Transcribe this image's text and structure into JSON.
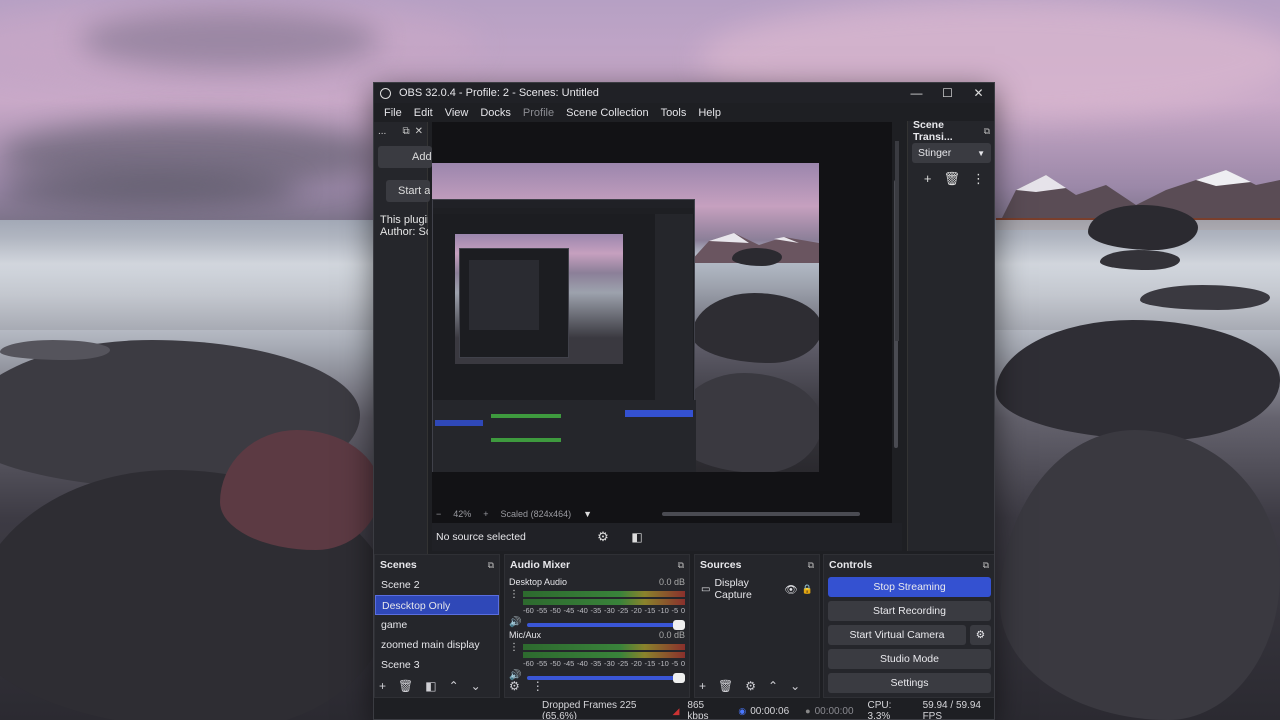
{
  "window": {
    "title": "OBS 32.0.4 - Profile: 2 - Scenes: Untitled",
    "minimize": "—",
    "maximize": "☐",
    "close": "✕"
  },
  "menu": [
    "File",
    "Edit",
    "View",
    "Docks",
    "Profile",
    "Scene Collection",
    "Tools",
    "Help"
  ],
  "left_dock": {
    "title": "...",
    "button1": "Add",
    "button2": "Start al",
    "line1": "This plugin",
    "line2": "Author: Sor"
  },
  "preview": {
    "zoom_minus": "−",
    "zoom_level": "42%",
    "zoom_plus": "+",
    "scale_mode": "Scaled (824x464)",
    "no_source": "No source selected"
  },
  "transitions": {
    "title": "Scene Transi...",
    "selected": "Stinger"
  },
  "scenes": {
    "title": "Scenes",
    "items": [
      "Scene 2",
      "Descktop Only",
      "game",
      "zoomed main display",
      "Scene 3"
    ],
    "selected_index": 1
  },
  "mixer": {
    "title": "Audio Mixer",
    "channels": [
      {
        "name": "Desktop Audio",
        "level": "0.0 dB"
      },
      {
        "name": "Mic/Aux",
        "level": "0.0 dB"
      }
    ],
    "scale": [
      "-60",
      "-55",
      "-50",
      "-45",
      "-40",
      "-35",
      "-30",
      "-25",
      "-20",
      "-15",
      "-10",
      "-5",
      "0"
    ]
  },
  "sources": {
    "title": "Sources",
    "items": [
      "Display Capture"
    ]
  },
  "controls": {
    "title": "Controls",
    "stop_streaming": "Stop Streaming",
    "start_recording": "Start Recording",
    "start_virtual_camera": "Start Virtual Camera",
    "studio_mode": "Studio Mode",
    "settings": "Settings"
  },
  "status": {
    "dropped_frames": "Dropped Frames 225 (65.6%)",
    "bitrate": "865 kbps",
    "stream_time": "00:00:06",
    "record_time": "00:00:00",
    "cpu": "CPU: 3.3%",
    "fps": "59.94 / 59.94 FPS"
  },
  "colors": {
    "accent": "#3451d1",
    "window_bg": "#1e1f23",
    "dock_bg": "#25262b"
  }
}
